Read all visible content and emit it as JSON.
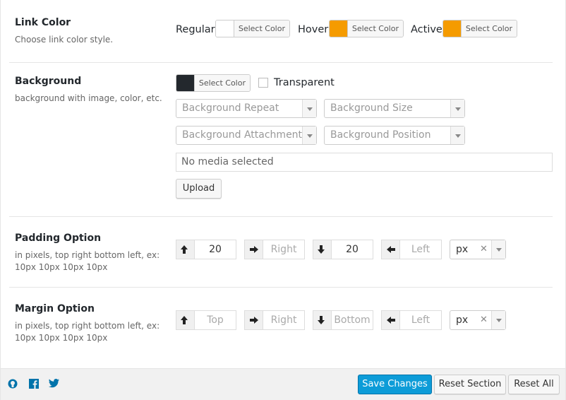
{
  "link_color": {
    "title": "Link Color",
    "desc": "Choose link color style.",
    "regular_label": "Regular",
    "hover_label": "Hover",
    "active_label": "Active",
    "select_color": "Select Color",
    "colors": {
      "regular": "#ffffff",
      "hover": "#f59b00",
      "active": "#f59b00"
    }
  },
  "background": {
    "title": "Background",
    "desc": "background with image, color, etc.",
    "select_color": "Select Color",
    "color": "#23282d",
    "transparent_label": "Transparent",
    "repeat_placeholder": "Background Repeat",
    "size_placeholder": "Background Size",
    "attachment_placeholder": "Background Attachment",
    "position_placeholder": "Background Position",
    "media_text": "No media selected",
    "upload_label": "Upload"
  },
  "padding": {
    "title": "Padding Option",
    "desc": "in pixels, top right bottom left, ex: 10px 10px 10px 10px",
    "top": "20",
    "right": "Right",
    "bottom": "20",
    "left": "Left",
    "unit": "px"
  },
  "margin": {
    "title": "Margin Option",
    "desc": "in pixels, top right bottom left, ex: 10px 10px 10px 10px",
    "top": "Top",
    "right": "Right",
    "bottom": "Bottom",
    "left": "Left",
    "unit": "px"
  },
  "footer": {
    "save": "Save Changes",
    "reset_section": "Reset Section",
    "reset_all": "Reset All",
    "icons": [
      "github-icon",
      "facebook-icon",
      "twitter-icon"
    ]
  }
}
